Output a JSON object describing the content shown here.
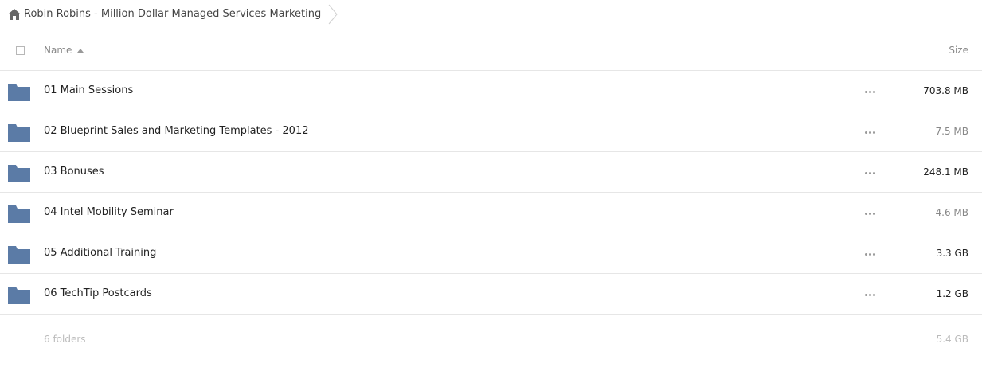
{
  "breadcrumb": {
    "home_icon": "home-icon",
    "title": "Robin Robins - Million Dollar Managed Services Marketing"
  },
  "header": {
    "name_label": "Name",
    "size_label": "Size",
    "sort_icon": "sort-ascending-icon"
  },
  "colors": {
    "folder": "#5b7ba6",
    "divider": "#e6e6e6",
    "muted_text": "#bbbbbb"
  },
  "rows": [
    {
      "name": "01 Main Sessions",
      "size": "703.8 MB"
    },
    {
      "name": "02 Blueprint Sales and Marketing Templates - 2012",
      "size": "7.5 MB"
    },
    {
      "name": "03 Bonuses",
      "size": "248.1 MB"
    },
    {
      "name": "04 Intel Mobility Seminar",
      "size": "4.6 MB"
    },
    {
      "name": "05 Additional Training",
      "size": "3.3 GB"
    },
    {
      "name": "06 TechTip Postcards",
      "size": "1.2 GB"
    }
  ],
  "footer": {
    "count": "6 folders",
    "total": "5.4 GB"
  }
}
